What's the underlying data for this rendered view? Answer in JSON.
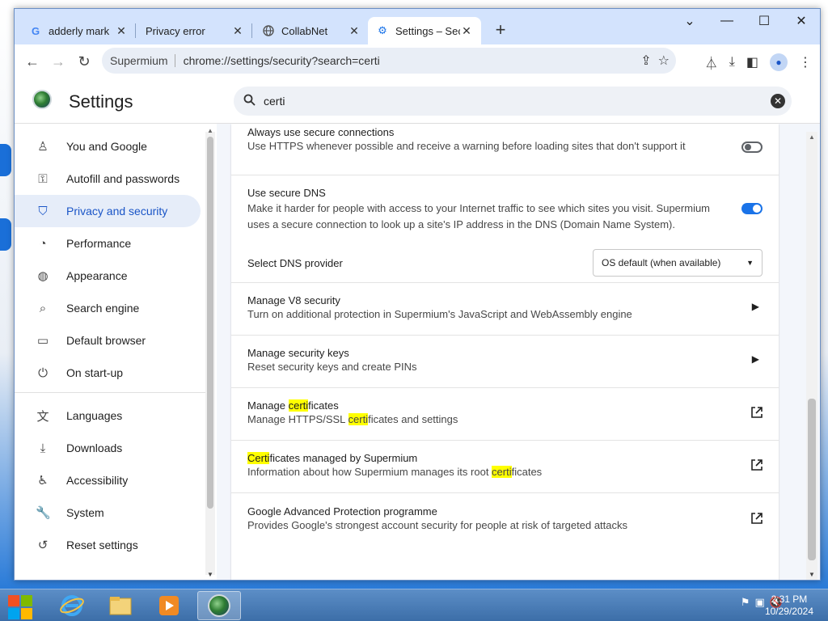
{
  "tabs": [
    {
      "title": "adderly mark",
      "icon": "google-icon"
    },
    {
      "title": "Privacy error",
      "icon": ""
    },
    {
      "title": "CollabNet",
      "icon": "globe-icon"
    },
    {
      "title": "Settings – Sec",
      "icon": "gear-icon",
      "active": true
    }
  ],
  "omnibox": {
    "site": "Supermium",
    "url": "chrome://settings/security?search=certi"
  },
  "settings": {
    "title": "Settings",
    "search_value": "certi"
  },
  "sidebar": {
    "items": [
      {
        "label": "You and Google",
        "icon": "person-icon"
      },
      {
        "label": "Autofill and passwords",
        "icon": "key-icon"
      },
      {
        "label": "Privacy and security",
        "icon": "shield-icon",
        "active": true
      },
      {
        "label": "Performance",
        "icon": "gauge-icon"
      },
      {
        "label": "Appearance",
        "icon": "palette-icon"
      },
      {
        "label": "Search engine",
        "icon": "search-icon"
      },
      {
        "label": "Default browser",
        "icon": "browser-window-icon"
      },
      {
        "label": "On start-up",
        "icon": "power-icon"
      }
    ],
    "items2": [
      {
        "label": "Languages",
        "icon": "translate-icon"
      },
      {
        "label": "Downloads",
        "icon": "download-icon"
      },
      {
        "label": "Accessibility",
        "icon": "accessibility-icon"
      },
      {
        "label": "System",
        "icon": "wrench-icon"
      },
      {
        "label": "Reset settings",
        "icon": "reset-icon"
      }
    ]
  },
  "rows": {
    "secure_conn": {
      "title": "Always use secure connections",
      "desc": "Use HTTPS whenever possible and receive a warning before loading sites that don't support it",
      "enabled": false
    },
    "secure_dns": {
      "title": "Use secure DNS",
      "desc1": "Make it harder for people with access to your Internet traffic to see which sites you visit. Supermium",
      "desc2": "uses a secure connection to look up a site's IP address in the DNS (Domain Name System).",
      "enabled": true
    },
    "dns_provider": {
      "label": "Select DNS provider",
      "selected": "OS default (when available)"
    },
    "v8": {
      "title": "Manage V8 security",
      "desc": "Turn on additional protection in Supermium's JavaScript and WebAssembly engine"
    },
    "keys": {
      "title": "Manage security keys",
      "desc": "Reset security keys and create PINs"
    },
    "certs": {
      "title_pre": "Manage ",
      "title_hl": "certi",
      "title_post": "ficates",
      "desc_pre": "Manage HTTPS/SSL ",
      "desc_hl": "certi",
      "desc_post": "ficates and settings"
    },
    "certs_managed": {
      "title_hl": "Certi",
      "title_post": "ficates managed by Supermium",
      "desc_pre": "Information about how Supermium manages its root ",
      "desc_hl": "certi",
      "desc_post": "ficates"
    },
    "gap": {
      "title": "Google Advanced Protection programme",
      "desc": "Provides Google's strongest account security for people at risk of targeted attacks"
    }
  },
  "taskbar": {
    "time": "2:31 PM",
    "date": "10/29/2024"
  },
  "colors": {
    "accent": "#1a73e8",
    "highlight": "#ffff00",
    "tabstrip": "#d3e3fd"
  }
}
